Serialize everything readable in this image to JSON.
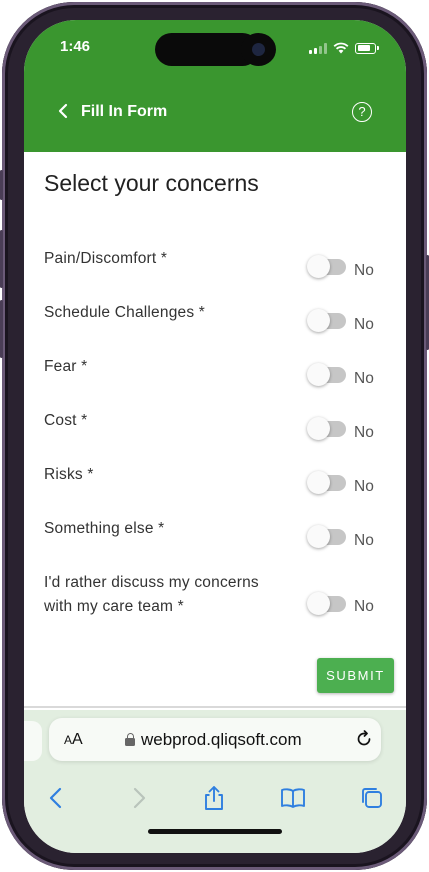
{
  "status_bar": {
    "time": "1:46"
  },
  "header": {
    "back_icon": "chevron-left-icon",
    "title": "Fill In Form",
    "help_icon": "question-circle-icon"
  },
  "form": {
    "title": "Select your concerns",
    "concerns": [
      {
        "label": "Pain/Discomfort *",
        "state": "No"
      },
      {
        "label": "Schedule Challenges *",
        "state": "No"
      },
      {
        "label": "Fear *",
        "state": "No"
      },
      {
        "label": "Cost *",
        "state": "No"
      },
      {
        "label": "Risks *",
        "state": "No"
      },
      {
        "label": "Something else *",
        "state": "No"
      },
      {
        "label_line1": "I'd rather discuss my concerns",
        "label_line2": "with my care team *",
        "state": "No"
      }
    ],
    "submit_label": "SUBMIT"
  },
  "browser": {
    "text_size_label_big": "A",
    "text_size_label_small": "A",
    "url": "webprod.qliqsoft.com",
    "icons": [
      "lock-icon",
      "reload-icon",
      "back-arrow-icon",
      "forward-arrow-icon",
      "share-icon",
      "bookmarks-icon",
      "tabs-icon"
    ]
  },
  "colors": {
    "header_green": "#3a962f",
    "submit_green": "#4caf50",
    "toolbar_blue": "#2f7fe0",
    "toolbar_bg": "#e2eee0"
  }
}
